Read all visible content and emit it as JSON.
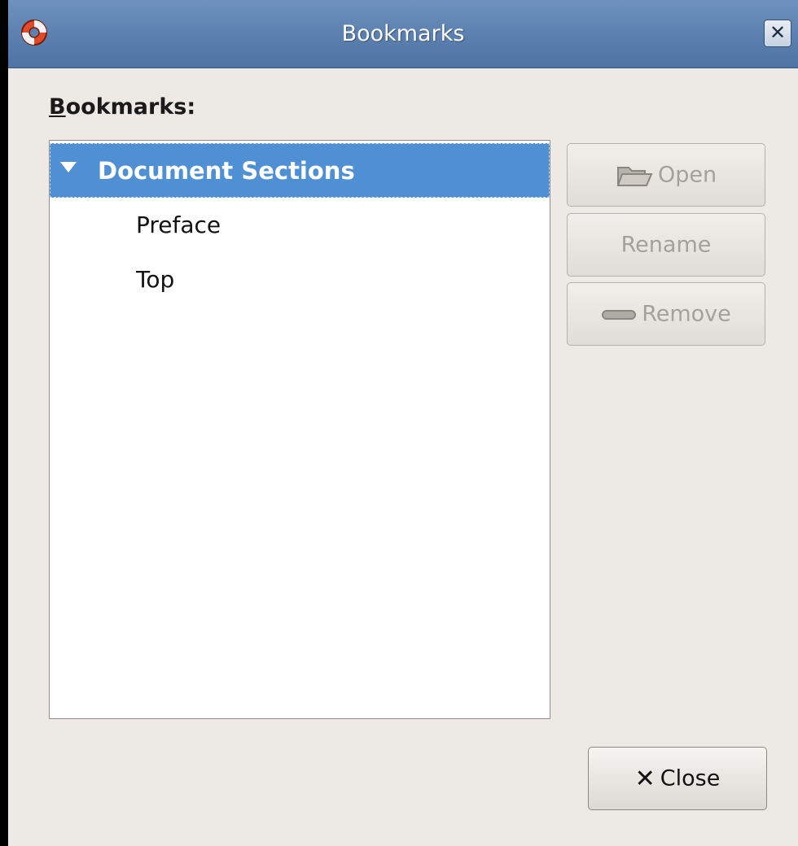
{
  "window": {
    "title": "Bookmarks"
  },
  "bookmarks_label": "Bookmarks:",
  "tree": {
    "section": "Document Sections",
    "items": [
      "Preface",
      "Top"
    ]
  },
  "buttons": {
    "open": "Open",
    "rename": "Rename",
    "remove": "Remove",
    "close": "Close"
  },
  "colors": {
    "selection": "#4f8fd4",
    "titlebar": "#5c81b0",
    "disabled_text": "#a4a19b"
  },
  "icons": {
    "app": "lifebuoy-icon",
    "window_close": "close-icon",
    "open": "folder-icon",
    "remove": "minus-icon",
    "close": "x-icon"
  }
}
